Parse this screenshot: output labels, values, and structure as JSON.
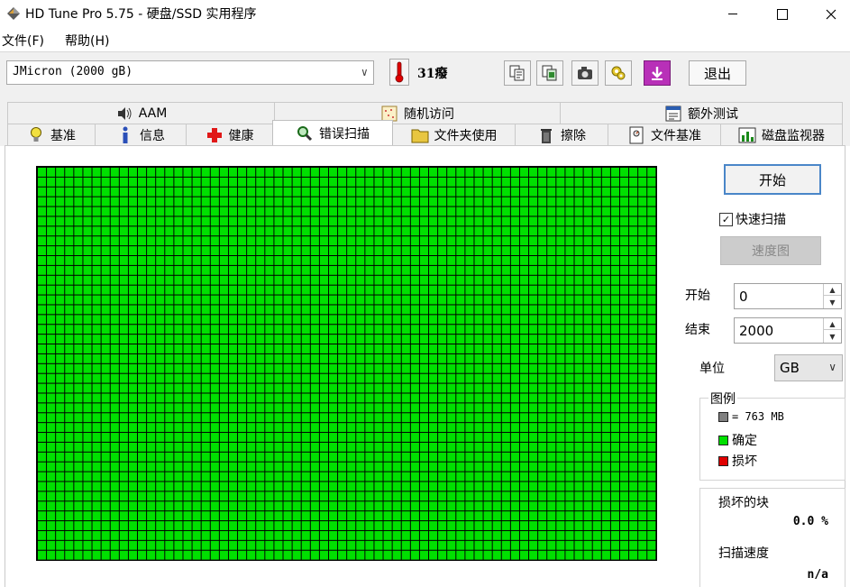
{
  "window": {
    "title": "HD Tune Pro 5.75 - 硬盘/SSD 实用程序",
    "minimize_icon": "minimize-icon",
    "maximize_icon": "maximize-icon",
    "close_icon": "close-icon"
  },
  "menu": [
    "文件(F)",
    "帮助(H)"
  ],
  "toolbar": {
    "drive": "JMicron  (2000 gB)",
    "temperature": "31癈",
    "buttons": [
      "copy-text-icon",
      "copy-screenshot-icon",
      "camera-icon",
      "options-icon",
      "download-icon"
    ],
    "exit_label": "退出"
  },
  "tabs": {
    "row1": [
      "AAM",
      "随机访问",
      "额外测试"
    ],
    "row2": [
      "基准",
      "信息",
      "健康",
      "错误扫描",
      "文件夹使用",
      "擦除",
      "文件基准",
      "磁盘监视器"
    ],
    "active": "错误扫描"
  },
  "scan": {
    "start_label": "开始",
    "quick_scan_label": "快速扫描",
    "quick_scan_checked": true,
    "speed_map_label": "速度图",
    "start_field_label": "开始",
    "start_value": "0",
    "end_field_label": "结束",
    "end_value": "2000",
    "unit_label": "单位",
    "unit_value": "GB"
  },
  "legend": {
    "title": "图例",
    "block_size": "= 763 MB",
    "ok_label": "确定",
    "damaged_label": "损坏",
    "colors": {
      "block": "#808080",
      "ok": "#00e000",
      "damaged": "#e00000"
    }
  },
  "stats": {
    "damaged_blocks_label": "损坏的块",
    "damaged_blocks_value": "0.0 %",
    "scan_speed_label": "扫描速度",
    "scan_speed_value": "n/a"
  },
  "grid": {
    "status": "ok",
    "columns": 68,
    "rows": 40
  }
}
